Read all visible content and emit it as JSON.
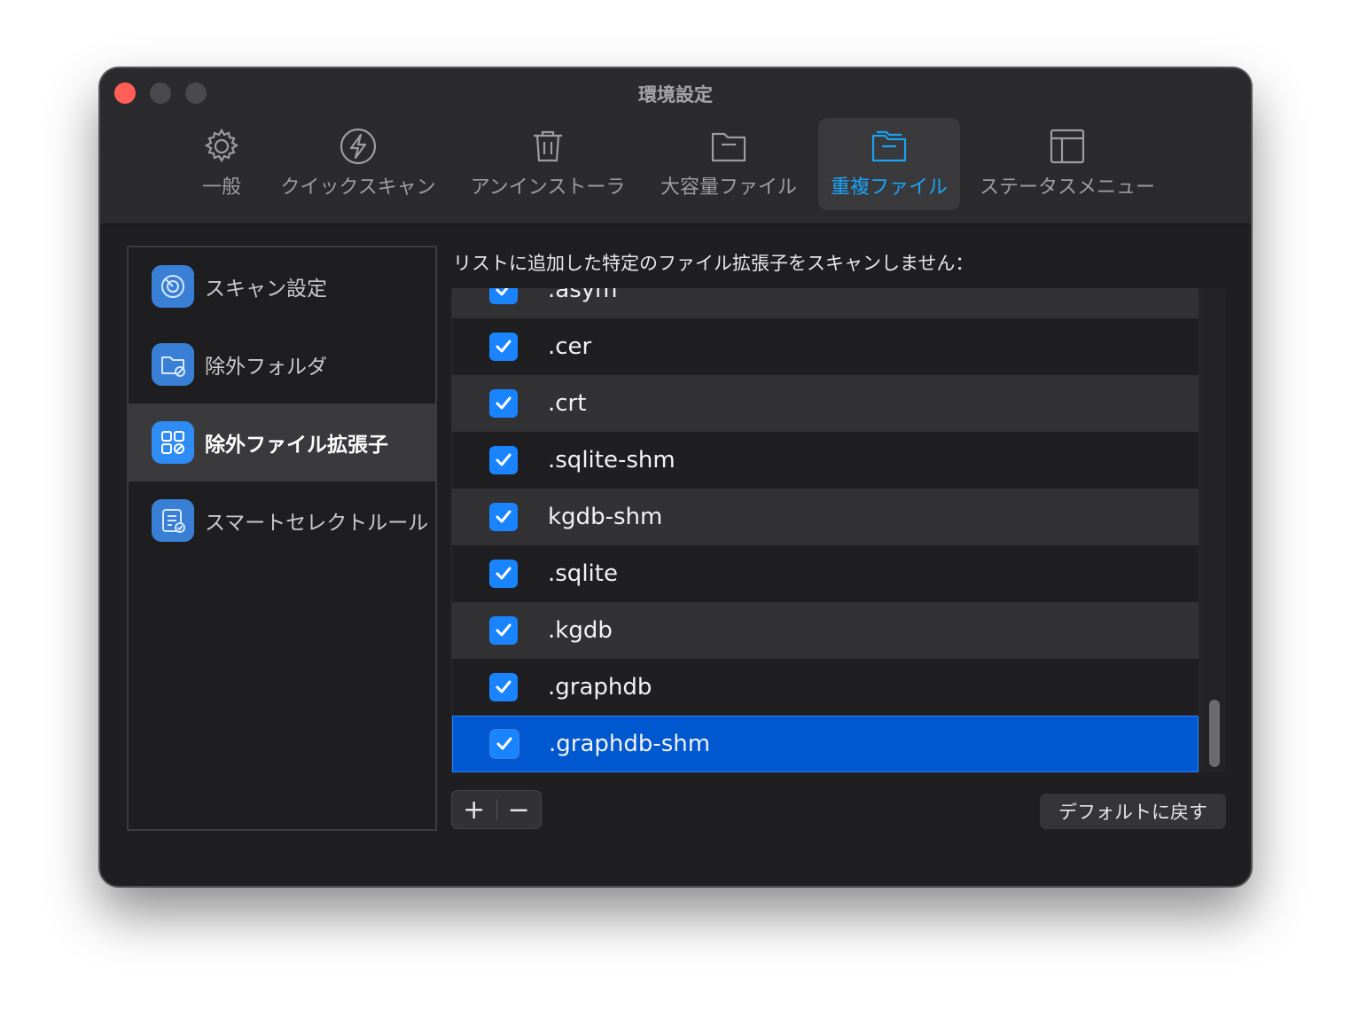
{
  "window": {
    "title": "環境設定"
  },
  "toolbar": {
    "tabs": [
      {
        "label": "一般",
        "icon": "gear-icon"
      },
      {
        "label": "クイックスキャン",
        "icon": "lightning-icon"
      },
      {
        "label": "アンインストーラ",
        "icon": "trash-icon"
      },
      {
        "label": "大容量ファイル",
        "icon": "folder-icon"
      },
      {
        "label": "重複ファイル",
        "icon": "duplicate-folder-icon",
        "active": true
      },
      {
        "label": "ステータスメニュー",
        "icon": "layout-icon"
      }
    ]
  },
  "sidebar": {
    "items": [
      {
        "label": "スキャン設定",
        "icon": "scan-radar-icon"
      },
      {
        "label": "除外フォルダ",
        "icon": "folder-exclude-icon"
      },
      {
        "label": "除外ファイル拡張子",
        "icon": "grid-exclude-icon",
        "active": true
      },
      {
        "label": "スマートセレクトルール",
        "icon": "rule-document-icon"
      }
    ]
  },
  "main": {
    "description": "リストに追加した特定のファイル拡張子をスキャンしません：",
    "extensions": [
      {
        "name": ".asym",
        "checked": true
      },
      {
        "name": ".cer",
        "checked": true
      },
      {
        "name": ".crt",
        "checked": true
      },
      {
        "name": ".sqlite-shm",
        "checked": true
      },
      {
        "name": "kgdb-shm",
        "checked": true
      },
      {
        "name": ".sqlite",
        "checked": true
      },
      {
        "name": ".kgdb",
        "checked": true
      },
      {
        "name": ".graphdb",
        "checked": true
      },
      {
        "name": ".graphdb-shm",
        "checked": true,
        "selected": true
      }
    ],
    "add_label": "+",
    "remove_label": "−",
    "default_button": "デフォルトに戻す"
  },
  "colors": {
    "accent": "#1a84ff",
    "selection": "#0058d0",
    "active_tab_text": "#1aa3f5",
    "close": "#ff5f57"
  }
}
